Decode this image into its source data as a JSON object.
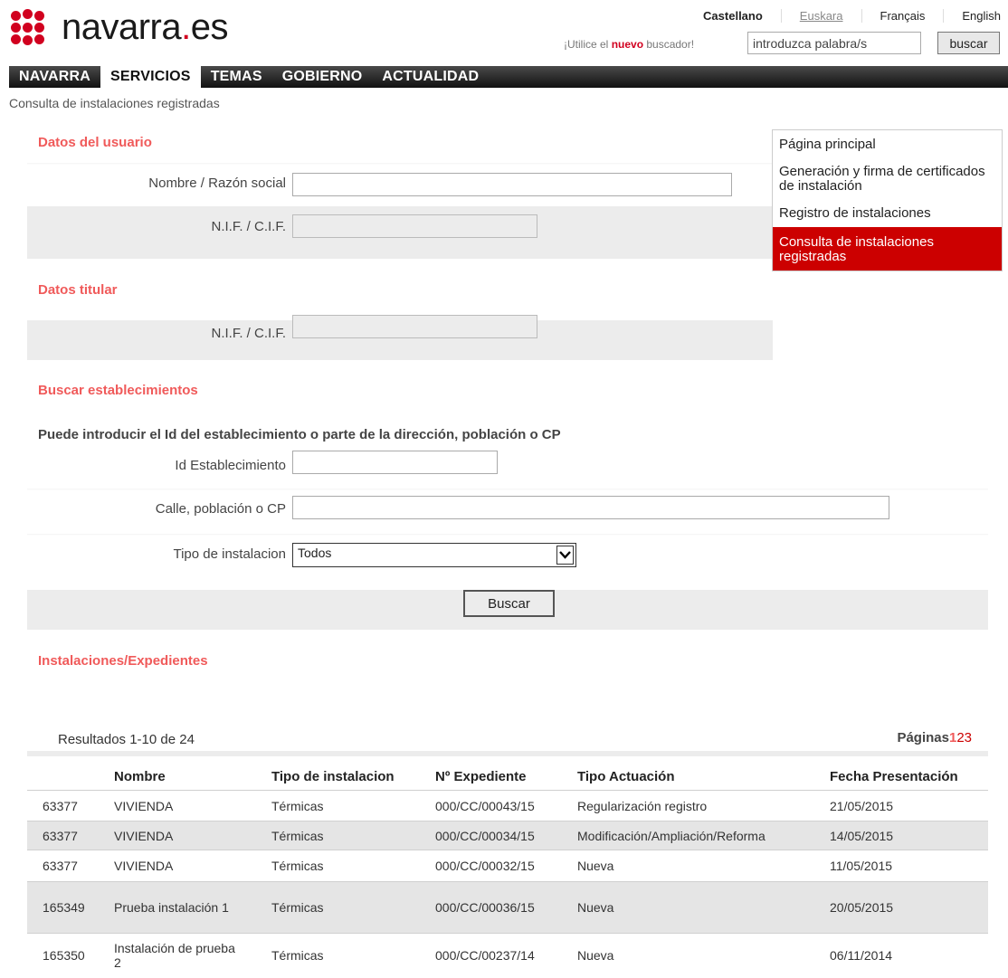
{
  "header": {
    "logo_text_main": "navarra",
    "logo_text_dot": ".",
    "logo_text_tld": "es",
    "languages": [
      {
        "label": "Castellano"
      },
      {
        "label": "Euskara"
      },
      {
        "label": "Français"
      },
      {
        "label": "English"
      }
    ],
    "search_note_pre": "¡Utilice el ",
    "search_note_new": "nuevo",
    "search_note_post": " buscador!",
    "search_value": "introduzca palabra/s",
    "search_button": "buscar"
  },
  "nav": {
    "items": [
      {
        "label": "NAVARRA"
      },
      {
        "label": "SERVICIOS"
      },
      {
        "label": "TEMAS"
      },
      {
        "label": "GOBIERNO"
      },
      {
        "label": "ACTUALIDAD"
      }
    ]
  },
  "breadcrumb": "Consulta de instalaciones registradas",
  "usuario": {
    "title": "Datos del usuario",
    "nombre_label": "Nombre / Razón social",
    "nif_label": "N.I.F. / C.I.F."
  },
  "titular": {
    "title": "Datos titular",
    "nif_label": "N.I.F. / C.I.F."
  },
  "buscar": {
    "title": "Buscar establecimientos",
    "hint": "Puede introducir el Id del establecimiento o parte de la dirección, población o CP",
    "id_label": "Id Establecimiento",
    "calle_label": "Calle, población o CP",
    "tipo_label": "Tipo de instalacion",
    "tipo_value": "Todos",
    "button": "Buscar"
  },
  "sidemenu": {
    "items": [
      {
        "label": "Página principal"
      },
      {
        "label": "Generación y firma de certificados de instalación"
      },
      {
        "label": "Registro de instalaciones"
      },
      {
        "label": "Consulta de instalaciones registradas"
      }
    ]
  },
  "results": {
    "title": "Instalaciones/Expedientes",
    "info": "Resultados 1-10 de 24",
    "pages_label": "Páginas",
    "pages": [
      "1",
      "2",
      "3"
    ],
    "columns": [
      "",
      "Nombre",
      "Tipo de instalacion",
      "Nº Expediente",
      "Tipo Actuación",
      "Fecha Presentación"
    ],
    "rows": [
      {
        "id": "63377",
        "nombre": "VIVIENDA",
        "tipo": "Térmicas",
        "expediente": "000/CC/00043/15",
        "actuacion": "Regularización registro",
        "fecha": "21/05/2015"
      },
      {
        "id": "63377",
        "nombre": "VIVIENDA",
        "tipo": "Térmicas",
        "expediente": "000/CC/00034/15",
        "actuacion": "Modificación/Ampliación/Reforma",
        "fecha": "14/05/2015"
      },
      {
        "id": "63377",
        "nombre": "VIVIENDA",
        "tipo": "Térmicas",
        "expediente": "000/CC/00032/15",
        "actuacion": "Nueva",
        "fecha": "11/05/2015"
      },
      {
        "id": "165349",
        "nombre": "Prueba instalación 1",
        "tipo": "Térmicas",
        "expediente": "000/CC/00036/15",
        "actuacion": "Nueva",
        "fecha": "20/05/2015"
      },
      {
        "id": "165350",
        "nombre": "Instalación de prueba 2",
        "tipo": "Térmicas",
        "expediente": "000/CC/00237/14",
        "actuacion": "Nueva",
        "fecha": "06/11/2014"
      }
    ]
  },
  "colors": {
    "brand_red": "#d1001f",
    "section_title": "#f05a5a",
    "menu_active": "#cc0000"
  }
}
